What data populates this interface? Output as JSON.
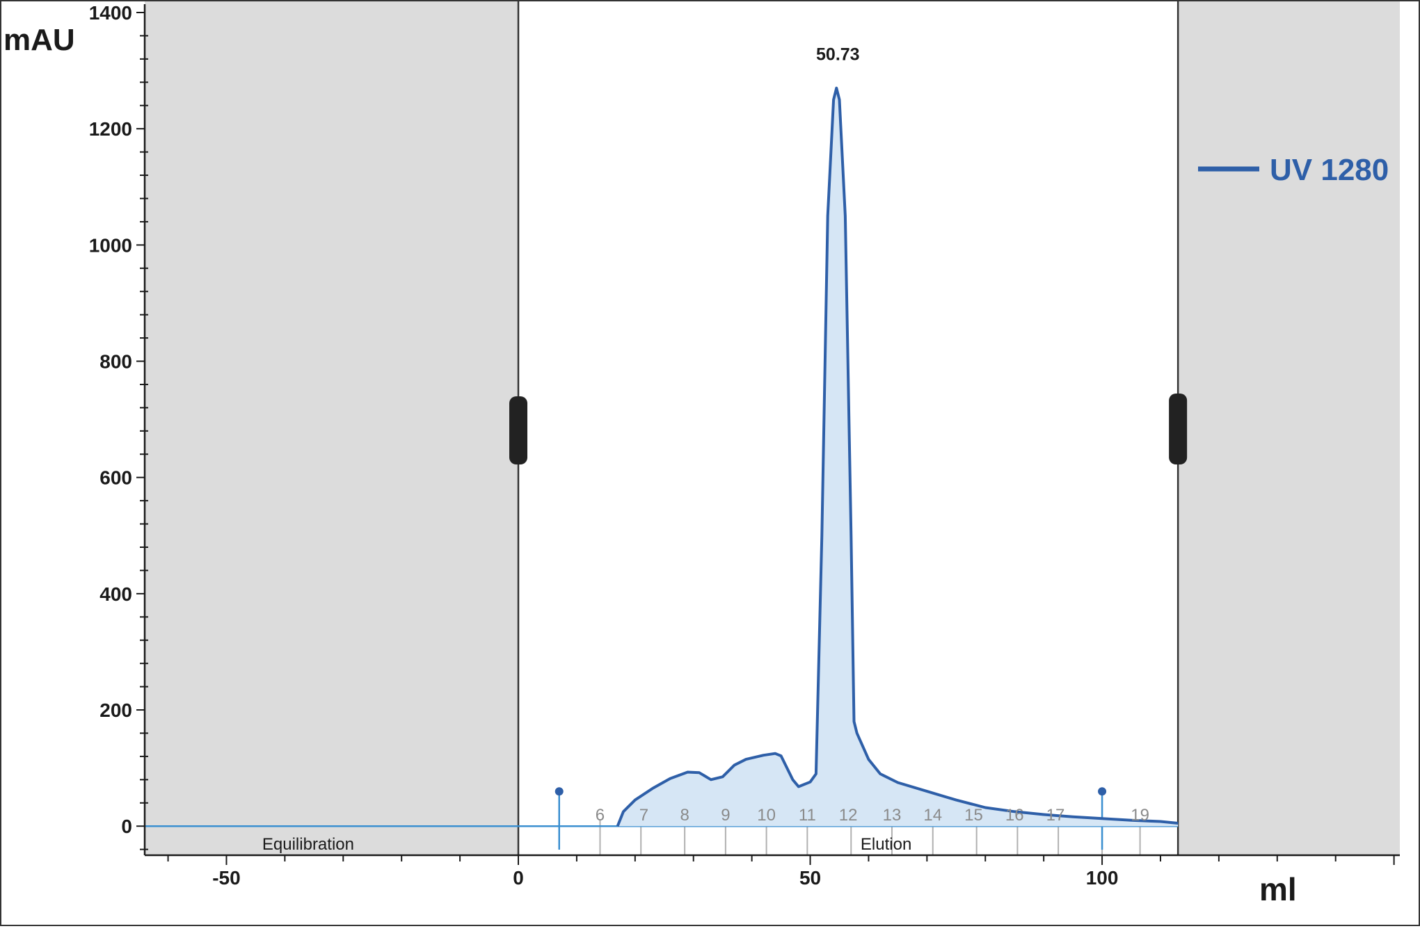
{
  "chart_data": {
    "type": "area",
    "ylabel": "mAU",
    "xlabel": "ml",
    "xlim": [
      -64,
      151
    ],
    "ylim": [
      -50,
      1400
    ],
    "y_ticks": [
      0,
      200,
      400,
      600,
      800,
      1000,
      1200,
      1400
    ],
    "x_ticks": [
      -50,
      0,
      50,
      100
    ],
    "view_window": [
      0,
      113
    ],
    "grid": false,
    "legend_position": "top-right",
    "series": [
      {
        "name": "UV 1280",
        "color": "#2e5fa8",
        "fill": "#d6e6f5",
        "x": [
          17,
          18,
          20,
          23,
          26,
          29,
          31,
          33,
          35,
          37,
          39,
          42,
          44,
          45,
          47,
          48,
          50,
          51,
          52,
          53,
          54,
          54.5,
          55,
          56,
          57,
          57.5,
          58,
          60,
          62,
          65,
          70,
          75,
          80,
          85,
          90,
          95,
          100,
          105,
          110,
          113
        ],
        "y": [
          0,
          25,
          45,
          65,
          82,
          93,
          92,
          80,
          85,
          105,
          115,
          122,
          125,
          121,
          80,
          68,
          76,
          90,
          500,
          1050,
          1250,
          1270,
          1250,
          1050,
          500,
          180,
          160,
          115,
          90,
          75,
          60,
          45,
          32,
          25,
          20,
          16,
          13,
          10,
          8,
          5
        ]
      }
    ],
    "peak_annotations": [
      {
        "label": "50.73",
        "x": 54.5,
        "y": 1270
      }
    ],
    "fractions": {
      "labels": [
        "6",
        "7",
        "8",
        "9",
        "10",
        "11",
        "12",
        "13",
        "14",
        "15",
        "16",
        "17",
        "19"
      ],
      "label_x": [
        14,
        21.5,
        28.5,
        35.5,
        42.5,
        49.5,
        56.5,
        64,
        71,
        78,
        85,
        92,
        106.5
      ],
      "boundaries": [
        14,
        21,
        28.5,
        35.5,
        42.5,
        49.5,
        57,
        64,
        71,
        78.5,
        85.5,
        92.5,
        100,
        106.5
      ]
    },
    "blocks": [
      {
        "label": "Equilibration",
        "x": -36
      },
      {
        "label": "Elution",
        "x": 63
      }
    ],
    "events_x": [
      7,
      100
    ],
    "baseline_color": "#3a8fd0"
  }
}
